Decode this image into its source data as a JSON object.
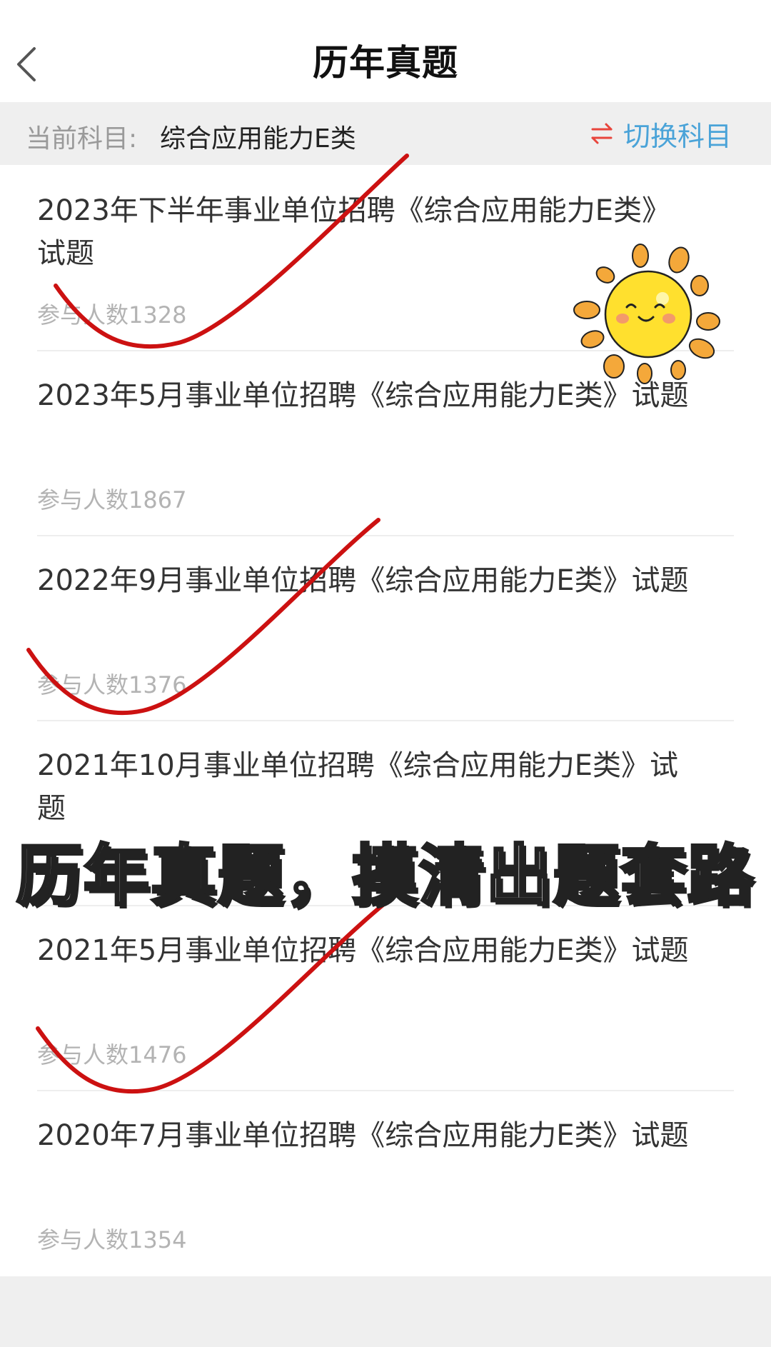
{
  "header": {
    "title": "历年真题",
    "back_icon": "chevron-left-icon"
  },
  "subject_bar": {
    "label": "当前科目:",
    "value": "综合应用能力E类",
    "switch_label": "切换科目",
    "switch_icon": "swap-arrows-icon",
    "switch_icon_color": "#e8453c",
    "switch_label_color": "#4aa3d8"
  },
  "items": [
    {
      "title": "2023年下半年事业单位招聘《综合应用能力E类》试题",
      "count": "参与人数1328"
    },
    {
      "title": "2023年5月事业单位招聘《综合应用能力E类》试题",
      "count": "参与人数1867"
    },
    {
      "title": "2022年9月事业单位招聘《综合应用能力E类》试题",
      "count": "参与人数1376"
    },
    {
      "title": "2021年10月事业单位招聘《综合应用能力E类》试题",
      "count": ""
    },
    {
      "title": "2021年5月事业单位招聘《综合应用能力E类》试题",
      "count": "参与人数1476"
    },
    {
      "title": "2020年7月事业单位招聘《综合应用能力E类》试题",
      "count": "参与人数1354"
    }
  ],
  "overlay": {
    "banner_text": "历年真题，摸清出题套路",
    "sticker": "smiling-sun-icon",
    "check_color": "#cc1111"
  }
}
